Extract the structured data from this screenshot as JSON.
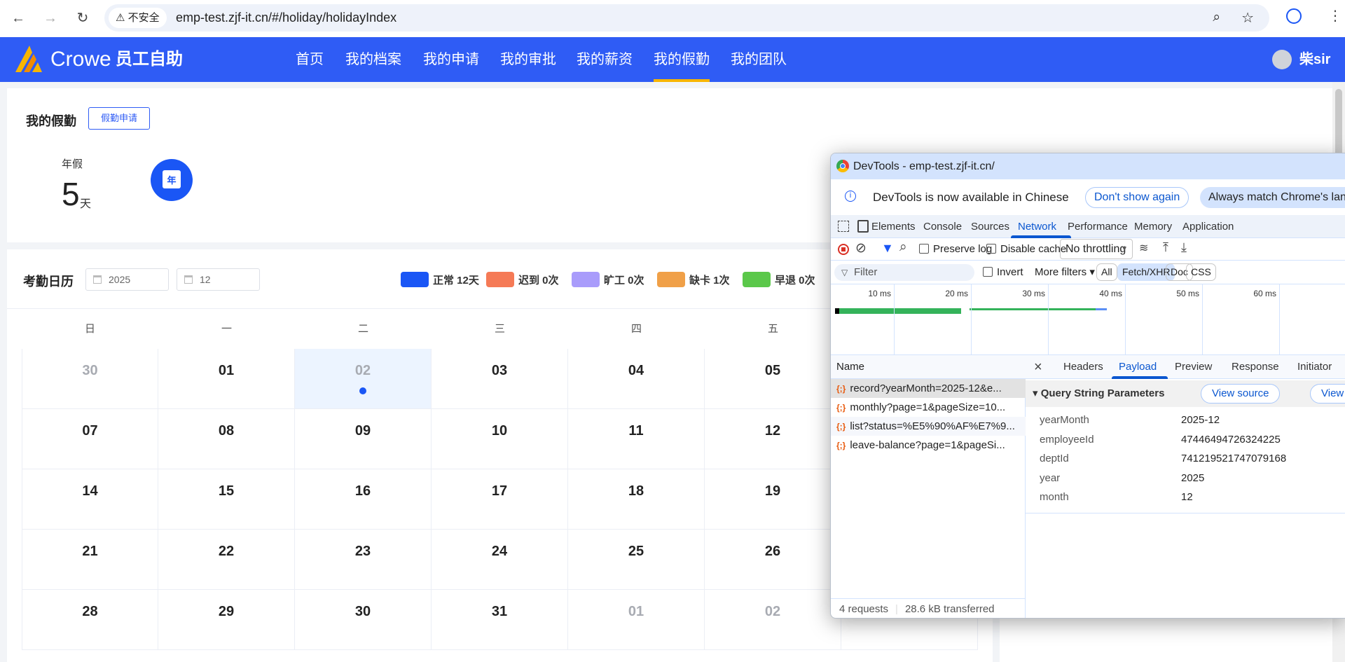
{
  "browser": {
    "insecure_label": "不安全",
    "url": "emp-test.zjf-it.cn/#/holiday/holidayIndex"
  },
  "header": {
    "logo_text": "Crowe",
    "app_name": "员工自助",
    "nav": [
      "首页",
      "我的档案",
      "我的申请",
      "我的审批",
      "我的薪资",
      "我的假勤",
      "我的团队"
    ],
    "active_nav": "我的假勤",
    "user": "柴sir"
  },
  "leave": {
    "title": "我的假勤",
    "apply_button": "假勤申请",
    "annual_label": "年假",
    "annual_value": "5",
    "annual_unit": "天",
    "icon_text": "年"
  },
  "calendar": {
    "title": "考勤日历",
    "year": "2025",
    "month": "12",
    "legend": [
      {
        "label": "正常 12天",
        "color": "#1a56f5"
      },
      {
        "label": "迟到 0次",
        "color": "#f57a56"
      },
      {
        "label": "旷工 0次",
        "color": "#a99cfb"
      },
      {
        "label": "缺卡 1次",
        "color": "#f0a048"
      },
      {
        "label": "早退 0次",
        "color": "#5bc84a"
      }
    ],
    "weekdays": [
      "日",
      "一",
      "二",
      "三",
      "四",
      "五"
    ],
    "weeks": [
      [
        "30",
        "01",
        "02",
        "03",
        "04",
        "05"
      ],
      [
        "07",
        "08",
        "09",
        "10",
        "11",
        "12"
      ],
      [
        "14",
        "15",
        "16",
        "17",
        "18",
        "19"
      ],
      [
        "21",
        "22",
        "23",
        "24",
        "25",
        "26"
      ],
      [
        "28",
        "29",
        "30",
        "31",
        "01",
        "02"
      ]
    ]
  },
  "devtools": {
    "title": "DevTools - emp-test.zjf-it.cn/",
    "info": "DevTools is now available in Chinese",
    "dont_show": "Don't show again",
    "always_match": "Always match Chrome's language",
    "tabs": [
      "Elements",
      "Console",
      "Sources",
      "Network",
      "Performance",
      "Memory",
      "Application"
    ],
    "active_tab": "Network",
    "preserve_log": "Preserve log",
    "disable_cache": "Disable cache",
    "throttling": "No throttling",
    "filter_placeholder": "Filter",
    "invert": "Invert",
    "more_filters": "More filters",
    "type_filters": [
      "All",
      "Fetch/XHR",
      "Doc",
      "CSS"
    ],
    "timeline_ticks": [
      "10 ms",
      "20 ms",
      "30 ms",
      "40 ms",
      "50 ms",
      "60 ms"
    ],
    "name_header": "Name",
    "requests": [
      "record?yearMonth=2025-12&e...",
      "monthly?page=1&pageSize=10...",
      "list?status=%E5%90%AF%E7%9...",
      "leave-balance?page=1&pageSi..."
    ],
    "detail_tabs": [
      "Headers",
      "Payload",
      "Preview",
      "Response",
      "Initiator"
    ],
    "active_detail": "Payload",
    "section_title": "Query String Parameters",
    "view_source": "View source",
    "view_decoded": "View URL-encoded",
    "params": [
      {
        "k": "yearMonth",
        "v": "2025-12"
      },
      {
        "k": "employeeId",
        "v": "47446494726324225"
      },
      {
        "k": "deptId",
        "v": "741219521747079168"
      },
      {
        "k": "year",
        "v": "2025"
      },
      {
        "k": "month",
        "v": "12"
      }
    ],
    "footer_requests": "4 requests",
    "footer_transferred": "28.6 kB transferred"
  }
}
